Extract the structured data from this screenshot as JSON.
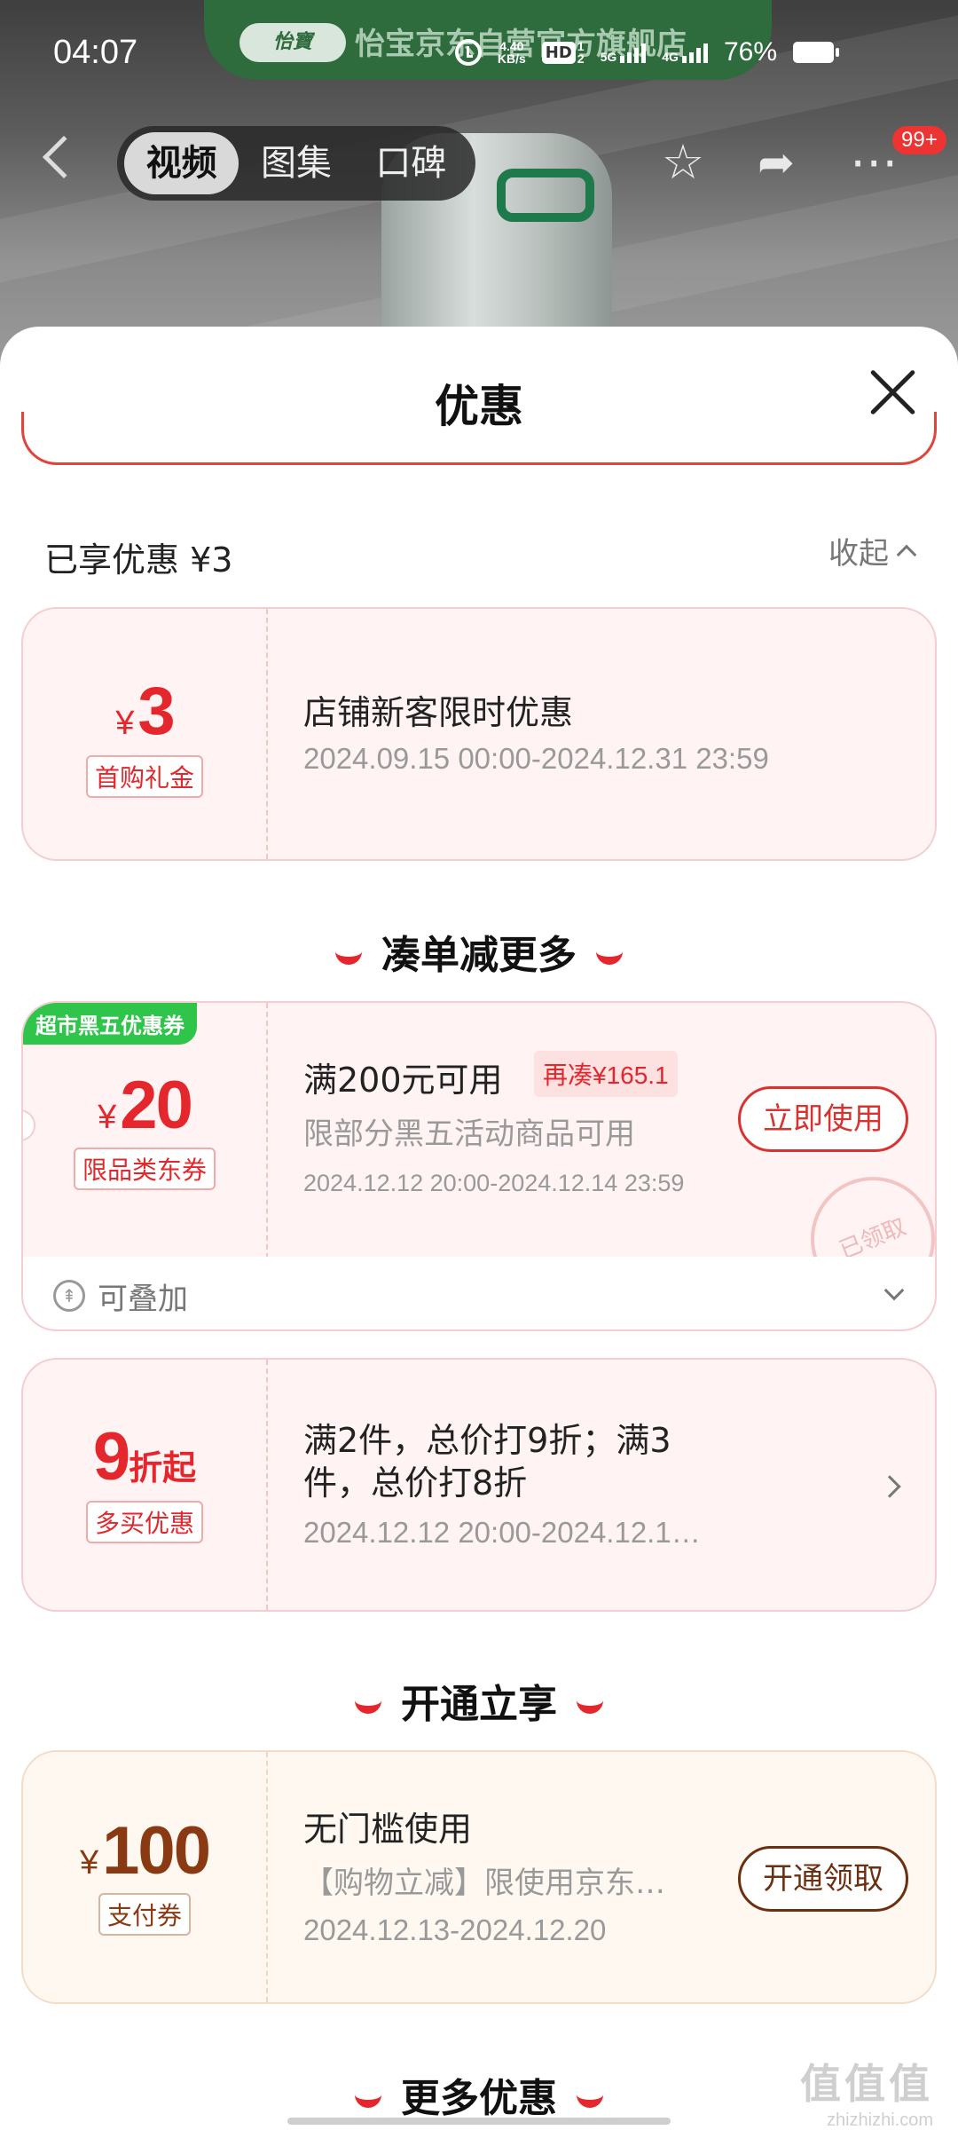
{
  "status_bar": {
    "time": "04:07",
    "net_speed_value": "4.40",
    "net_speed_unit": "KB/s",
    "hd_label": "HD",
    "sim1_label": "1",
    "sim2_label": "2",
    "net1": "5G",
    "net2": "4G",
    "battery": "76%"
  },
  "background": {
    "store_banner": "怡宝京东自营官方旗舰店",
    "logo_text": "怡寶"
  },
  "nav": {
    "tabs": [
      "视频",
      "图集",
      "口碑"
    ],
    "active_tab": "视频",
    "more_badge": "99+"
  },
  "sheet": {
    "title": "优惠",
    "enjoyed_label": "已享优惠 ¥3",
    "collapse_label": "收起"
  },
  "card_new_customer": {
    "currency": "¥",
    "amount": "3",
    "tag": "首购礼金",
    "title": "店铺新客限时优惠",
    "date": "2024.09.15 00:00-2024.12.31 23:59"
  },
  "section_more": "凑单减更多",
  "card_black_five": {
    "corner_badge": "超市黑五优惠券",
    "currency": "¥",
    "amount": "20",
    "tag": "限品类东券",
    "title": "满200元可用",
    "needed": "再凑¥165.1",
    "subtitle": "限部分黑五活动商品可用",
    "date": "2024.12.12 20:00-2024.12.14 23:59",
    "button": "立即使用",
    "stamp": "已领取",
    "stackable": "可叠加"
  },
  "card_multi_buy": {
    "amount": "9",
    "unit": "折起",
    "tag": "多买优惠",
    "title_line1": "满2件，总价打9折；满3",
    "title_line2": "件，总价打8折",
    "date": "2024.12.12 20:00-2024.12.1…"
  },
  "section_open": "开通立享",
  "card_pay": {
    "currency": "¥",
    "amount": "100",
    "tag": "支付券",
    "title": "无门槛使用",
    "subtitle": "【购物立减】限使用京东…",
    "date": "2024.12.13-2024.12.20",
    "button": "开通领取"
  },
  "section_more_offers": "更多优惠",
  "watermark": {
    "big": "值值值",
    "small": "zhizhizhi.com"
  },
  "colors": {
    "accent_red": "#e3272c",
    "gold_brown": "#8a3a12",
    "green_badge": "#2fc54a"
  }
}
